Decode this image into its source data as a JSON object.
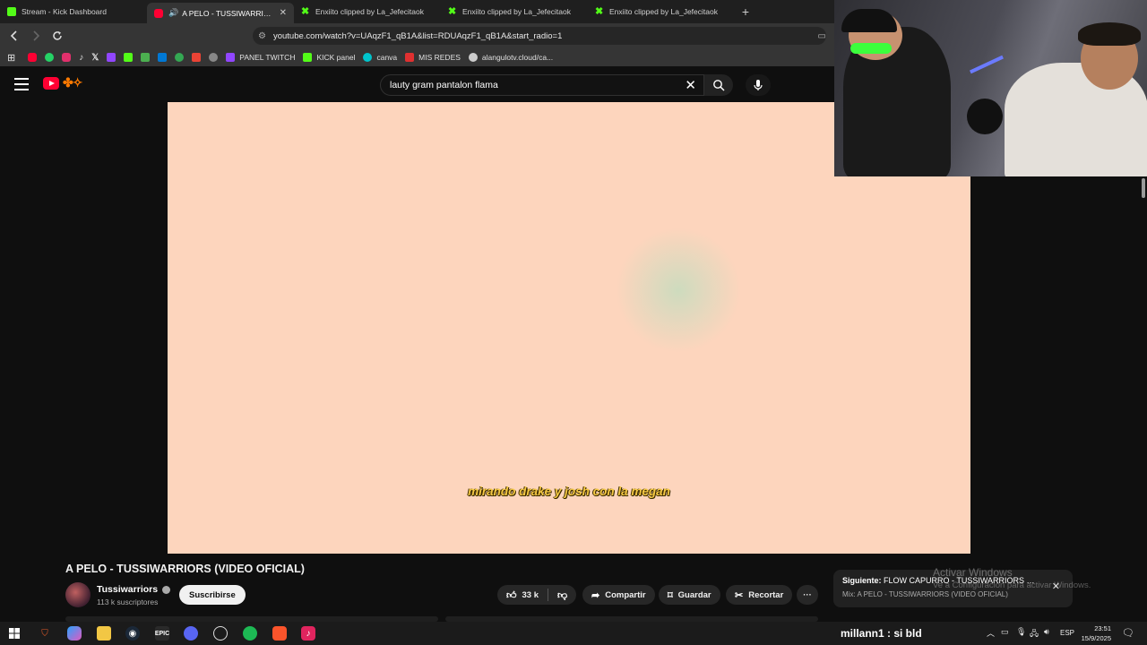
{
  "browser": {
    "tabs": [
      {
        "label": "Stream - Kick Dashboard",
        "icon": "kick-icon",
        "active": false
      },
      {
        "label": "A PELO - TUSSIWARRIORS (V",
        "icon": "youtube-icon",
        "active": true
      },
      {
        "label": "Enxiito clipped by La_Jefecitaok",
        "icon": "kick-clip-icon",
        "active": false
      },
      {
        "label": "Enxiito clipped by La_Jefecitaok",
        "icon": "kick-clip-icon",
        "active": false
      },
      {
        "label": "Enxiito clipped by La_Jefecitaok",
        "icon": "kick-clip-icon",
        "active": false
      }
    ],
    "new_tab": "+",
    "url": "youtube.com/watch?v=UAqzF1_qB1A&list=RDUAqzF1_qB1A&start_radio=1",
    "bookmarks": [
      {
        "label": "",
        "color": "#ff0033"
      },
      {
        "label": "",
        "color": "#25d366"
      },
      {
        "label": "",
        "color": "#e1306c"
      },
      {
        "label": "",
        "color": "#000000"
      },
      {
        "label": "",
        "color": "#000000"
      },
      {
        "label": "",
        "color": "#9146ff"
      },
      {
        "label": "",
        "color": "#53fc18"
      },
      {
        "label": "",
        "color": "#4caf50"
      },
      {
        "label": "",
        "color": "#0078d4"
      },
      {
        "label": "",
        "color": "#34a853"
      },
      {
        "label": "",
        "color": "#ea4335"
      },
      {
        "label": "",
        "color": "#888888"
      },
      {
        "label": "PANEL TWITCH",
        "color": "#9146ff"
      },
      {
        "label": "KICK panel",
        "color": "#53fc18"
      },
      {
        "label": "canva",
        "color": "#00c4cc"
      },
      {
        "label": "MIS REDES",
        "color": "#e03030"
      },
      {
        "label": "alangulotv.cloud/ca...",
        "color": "#cccccc"
      }
    ]
  },
  "youtube": {
    "search_query": "lauty gram pantalon flama",
    "video": {
      "subtitle": "mirando drake y josh con la megan",
      "title": "A PELO - TUSSIWARRIORS (VIDEO OFICIAL)",
      "channel": "Tussiwarriors",
      "subscribers": "113 k suscriptores",
      "subscribe_label": "Suscribirse",
      "likes": "33 k",
      "share_label": "Compartir",
      "save_label": "Guardar",
      "clip_label": "Recortar",
      "more_label": "···"
    },
    "next_card": {
      "prefix": "Siguiente:",
      "title": "FLOW CAPURRO - TUSSIWARRIORS FT T...",
      "mix": "Mix: A PELO - TUSSIWARRIORS (VIDEO OFICIAL)",
      "close": "✕"
    }
  },
  "overlay": {
    "chat_line": "millann1 : si bld",
    "watermark_title": "Activar Windows",
    "watermark_sub": "Ve a Configuración para activar Windows."
  },
  "taskbar": {
    "language": "ESP",
    "time": "23:51",
    "date": "15/9/2025"
  }
}
